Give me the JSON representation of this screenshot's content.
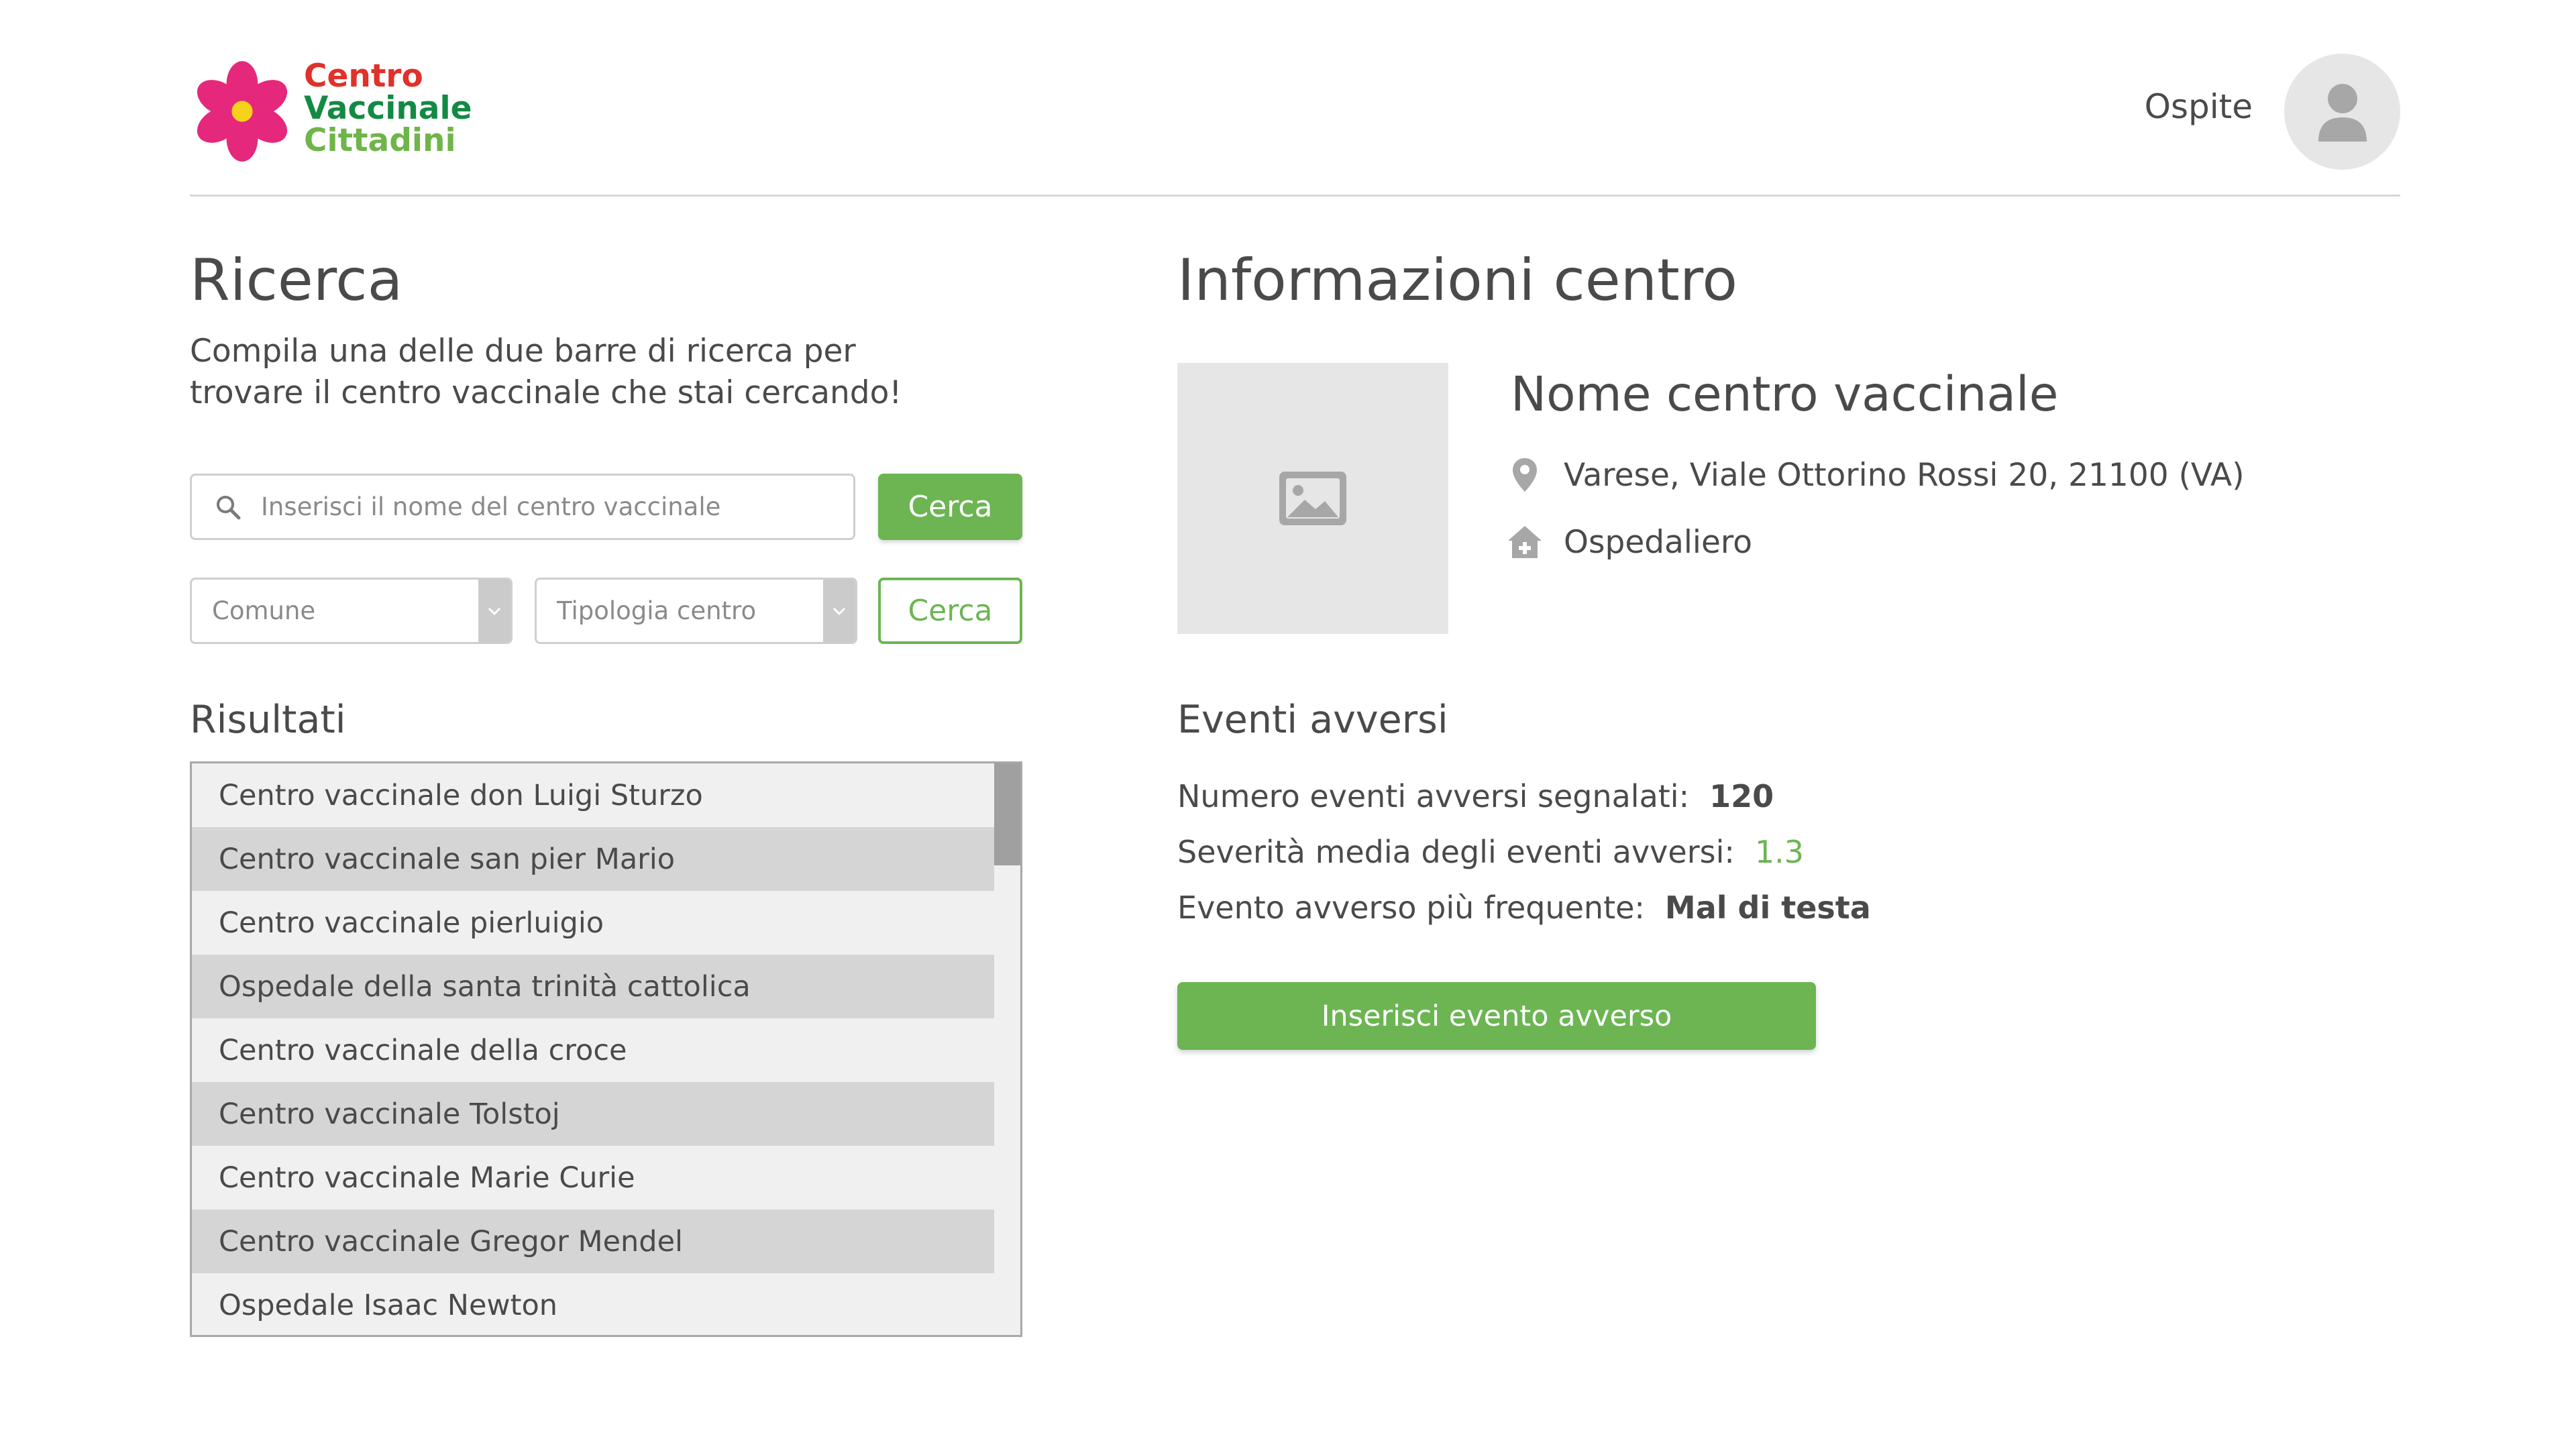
{
  "header": {
    "logo": {
      "line1": "Centro",
      "line2": "Vaccinale",
      "line3": "Cittadini"
    },
    "user_name": "Ospite",
    "avatar_icon": "user-icon"
  },
  "search": {
    "title": "Ricerca",
    "description": "Compila una delle due barre di ricerca per trovare il centro vaccinale che stai cercando!",
    "name_placeholder": "Inserisci il nome del centro vaccinale",
    "search_button_label": "Cerca",
    "comune_value": "Comune",
    "tipologia_value": "Tipologia centro",
    "filter_button_label": "Cerca"
  },
  "results": {
    "title": "Risultati",
    "items": [
      "Centro vaccinale don Luigi Sturzo",
      "Centro vaccinale san pier Mario",
      "Centro vaccinale pierluigio",
      "Ospedale della santa trinità cattolica",
      "Centro vaccinale della croce",
      "Centro vaccinale Tolstoj",
      "Centro vaccinale Marie Curie",
      "Centro vaccinale Gregor Mendel",
      "Ospedale Isaac Newton"
    ]
  },
  "info": {
    "title": "Informazioni centro",
    "center_name": "Nome centro vaccinale",
    "address": "Varese, Viale Ottorino Rossi 20, 21100 (VA)",
    "type": "Ospedaliero"
  },
  "events": {
    "title": "Eventi avversi",
    "count_label": "Numero eventi avversi segnalati:",
    "count_value": "120",
    "severity_label": "Severità media degli eventi avversi:",
    "severity_value": "1.3",
    "frequent_label": "Evento avverso più frequente:",
    "frequent_value": "Mal di testa",
    "insert_button_label": "Inserisci evento avverso"
  },
  "colors": {
    "accent_green": "#6cb552",
    "logo_red": "#e0312b",
    "logo_dark_green": "#138a44",
    "logo_magenta": "#e5287c"
  }
}
